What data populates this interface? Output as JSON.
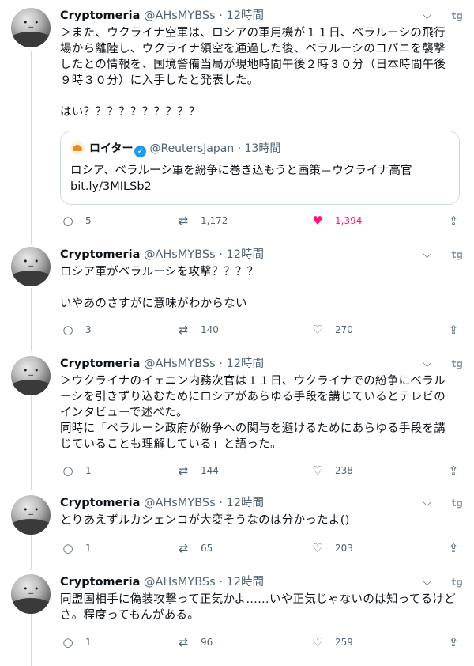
{
  "tweets": [
    {
      "name": "Cryptomeria",
      "handle": "@AHsMYBSs",
      "time": "12時間",
      "text": "＞また、ウクライナ空軍は、ロシアの軍用機が１１日、ベラルーシの飛行\n場から離陸し、ウクライナ領空を通過した後、ベラルーシのコパニを襲撃\nしたとの情報を、国境警備当局が現地時間午後２時３０分（日本時間午後\n９時３０分）に入手したと発表した。\n\nはい？？？？？？？？？？",
      "quote": {
        "name": "ロイター",
        "handle": "@ReutersJapan",
        "time": "13時間",
        "text": "ロシア、ベラルーシ軍を紛争に巻き込もうと画策＝ウクライナ高官\nbit.ly/3MILSb2"
      },
      "replies": "5",
      "retweets": "1,172",
      "likes": "1,394",
      "liked": true
    },
    {
      "name": "Cryptomeria",
      "handle": "@AHsMYBSs",
      "time": "12時間",
      "text": "ロシア軍がベラルーシを攻撃？？？？\n\nいやあのさすがに意味がわからない",
      "replies": "3",
      "retweets": "140",
      "likes": "270",
      "liked": false
    },
    {
      "name": "Cryptomeria",
      "handle": "@AHsMYBSs",
      "time": "12時間",
      "text": "＞ウクライナのイェニン内務次官は１１日、ウクライナでの紛争にベラル\nーシを引きずり込むためにロシアがあらゆる手段を講じているとテレビの\nインタビューで述べた。\n同時に「ベラルーシ政府が紛争への関与を避けるためにあらゆる手段を講\nじていることも理解している」と語った。",
      "replies": "1",
      "retweets": "144",
      "likes": "238",
      "liked": false
    },
    {
      "name": "Cryptomeria",
      "handle": "@AHsMYBSs",
      "time": "12時間",
      "text": "とりあえずルカシェンコが大変そうなのは分かったよ()",
      "replies": "1",
      "retweets": "65",
      "likes": "203",
      "liked": false
    },
    {
      "name": "Cryptomeria",
      "handle": "@AHsMYBSs",
      "time": "12時間",
      "text": "同盟国相手に偽装攻撃って正気かよ……いや正気じゃないのは知ってるけど\nさ。程度ってもんがある。",
      "replies": "1",
      "retweets": "96",
      "likes": "259",
      "liked": false
    }
  ],
  "icons": {
    "reply": "speech-bubble-icon",
    "retweet": "retweet-arrows-icon",
    "like": "heart-icon",
    "share": "share-upload-icon",
    "more": "chevron-down-icon",
    "brand": "tweetdeck-icon"
  },
  "colors": {
    "like_active": "#f91880",
    "muted": "#536471",
    "verified": "#1d9bf0",
    "thread_line": "#cfd9de"
  }
}
